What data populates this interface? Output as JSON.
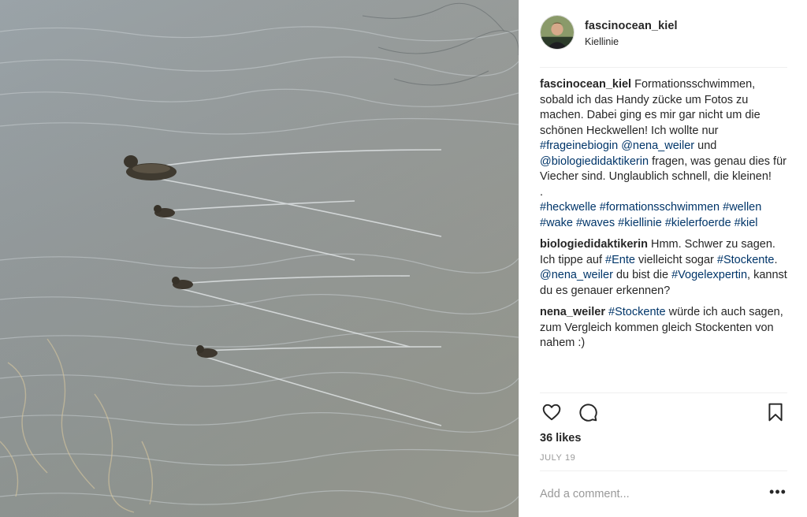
{
  "post": {
    "author": "fascinocean_kiel",
    "location": "Kiellinie",
    "image_subject": "ducklings-on-water",
    "likes": "36 likes",
    "date": "JULY 19"
  },
  "caption": {
    "user": "fascinocean_kiel",
    "text1": " Formationsschwimmen, sobald ich das Handy zücke um Fotos zu machen. Dabei ging es mir gar nicht um die schönen Heckwellen! Ich wollte nur ",
    "tag1": "#frageinebiogin",
    "space1": " ",
    "mention1": "@nena_weiler",
    "text2": " und ",
    "mention2": "@biologiedidaktikerin",
    "text3": " fragen, was genau dies für Viecher sind. Unglaublich schnell, die kleinen!",
    "dot": ".",
    "hashtags": [
      "#heckwelle",
      "#formationsschwimmen",
      "#wellen",
      "#wake",
      "#waves",
      "#kiellinie",
      "#kielerfoerde",
      "#kiel"
    ]
  },
  "comments": [
    {
      "user": "biologiedidaktikerin",
      "t1": " Hmm. Schwer zu sagen. Ich tippe auf ",
      "tag1": "#Ente",
      "t2": " vielleicht sogar ",
      "tag2": "#Stockente",
      "t3": ". ",
      "mention": "@nena_weiler",
      "t4": " du bist die ",
      "tag3": "#Vogelexpertin",
      "t5": ", kannst du es genauer erkennen?"
    },
    {
      "user": "nena_weiler",
      "t1": " ",
      "tag1": "#Stockente",
      "t2": " würde ich auch sagen, zum Vergleich kommen gleich Stockenten von nahem :)"
    }
  ],
  "actions": {
    "like_icon": "heart-icon",
    "comment_icon": "comment-bubble-icon",
    "save_icon": "bookmark-icon"
  },
  "composer": {
    "placeholder": "Add a comment...",
    "more_label": "•••"
  },
  "colors": {
    "link": "#003569",
    "text": "#262626",
    "muted": "#999999",
    "border": "#efefef"
  }
}
